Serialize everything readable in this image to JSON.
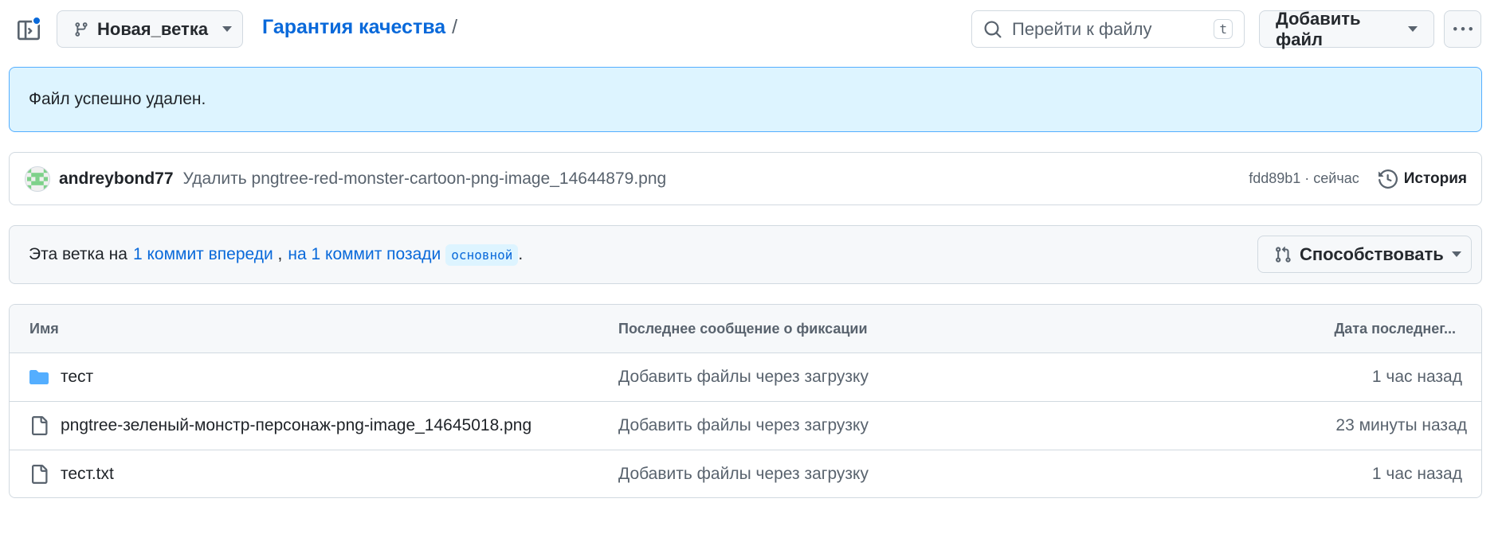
{
  "header": {
    "branch_name": "Новая_ветка",
    "breadcrumb_repo": "Гарантия качества",
    "breadcrumb_separator": "/",
    "search_placeholder": "Перейти к файлу",
    "search_shortcut": "t",
    "add_file_label": "Добавить файл"
  },
  "flash": {
    "message": "Файл успешно удален."
  },
  "commit": {
    "author": "andreybond77",
    "message": "Удалить pngtree-red-monster-cartoon-png-image_14644879.png",
    "meta": "fdd89b1 · сейчас",
    "history_label": "История"
  },
  "branch_status": {
    "prefix": "Эта ветка на",
    "ahead": "1 коммит впереди",
    "separator": " ,",
    "behind": "на 1 коммит позади",
    "base_branch": "основной",
    "suffix": ".",
    "contribute_label": "Способствовать"
  },
  "files": {
    "columns": [
      "Имя",
      "Последнее сообщение о фиксации",
      "Дата последнег..."
    ],
    "rows": [
      {
        "type": "folder",
        "name": "тест",
        "message": "Добавить файлы через загрузку",
        "date": "1 час назад"
      },
      {
        "type": "file",
        "name": "pngtree-зеленый-монстр-персонаж-png-image_14645018.png",
        "message": "Добавить файлы через загрузку",
        "date": "23 минуты назад"
      },
      {
        "type": "file",
        "name": "тест.txt",
        "message": "Добавить файлы через загрузку",
        "date": "1 час назад"
      }
    ]
  },
  "colors": {
    "link": "#0969da",
    "flash_bg": "#ddf4ff",
    "flash_border": "#54aeff",
    "folder_icon": "#54aeff",
    "notification_dot": "#0969da"
  }
}
